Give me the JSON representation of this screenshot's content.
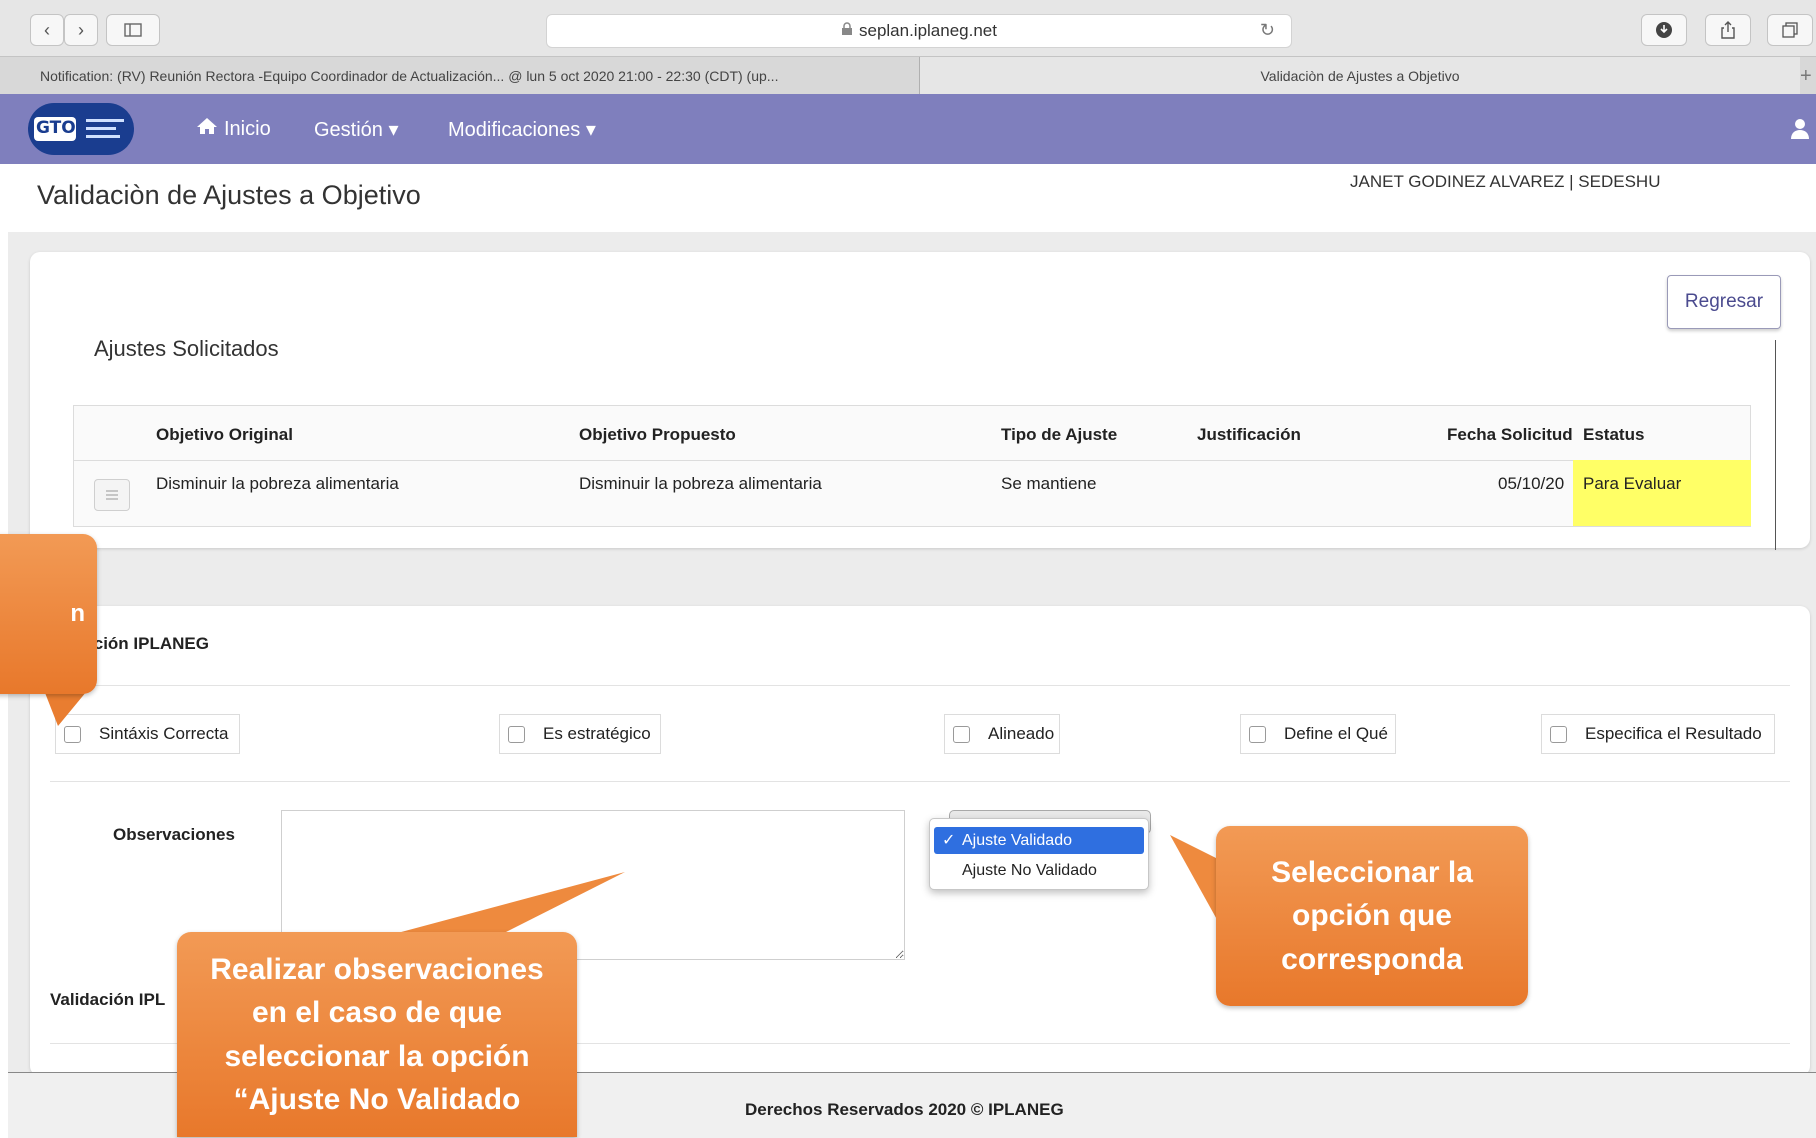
{
  "browser": {
    "url": "seplan.iplaneg.net",
    "lock_icon": "lock-icon",
    "tabs": [
      {
        "label": "Notification: (RV) Reunión Rectora -Equipo Coordinador de Actualización... @ lun 5 oct 2020 21:00 - 22:30 (CDT) (up..."
      },
      {
        "label": "Validaciòn de Ajustes a Objetivo"
      }
    ],
    "new_tab": "+"
  },
  "nav": {
    "logo_text": "GTO",
    "items": [
      {
        "label": "Inicio",
        "icon": "home-icon"
      },
      {
        "label": "Gestión ▾"
      },
      {
        "label": "Modificaciones ▾"
      }
    ]
  },
  "page": {
    "title": "Validaciòn de Ajustes a Objetivo",
    "user": "JANET GODINEZ ALVAREZ | SEDESHU"
  },
  "ajustes": {
    "back_button": "Regresar",
    "section_title": "Ajustes Solicitados",
    "columns": [
      "Objetivo Original",
      "Objetivo Propuesto",
      "Tipo de Ajuste",
      "Justificación",
      "Fecha Solicitud",
      "Estatus"
    ],
    "rows": [
      {
        "objetivo_original": "Disminuir la pobreza alimentaria",
        "objetivo_propuesto": "Disminuir la pobreza alimentaria",
        "tipo": "Se mantiene",
        "justificacion": "",
        "fecha": "05/10/20",
        "estatus": "Para Evaluar"
      }
    ],
    "status_color": "#ffff66"
  },
  "validacion": {
    "section_title": "alidación IPLANEG",
    "checkboxes": [
      {
        "label": "Sintáxis Correcta"
      },
      {
        "label": "Es estratégico"
      },
      {
        "label": "Alineado"
      },
      {
        "label": "Define el Qué"
      },
      {
        "label": "Especifica el Resultado"
      }
    ],
    "observaciones_label": "Observaciones",
    "dropdown_options": [
      {
        "label": "Ajuste Validado",
        "selected": true
      },
      {
        "label": "Ajuste No Validado",
        "selected": false
      }
    ],
    "bottom_label": "Validación IPL"
  },
  "footer": {
    "text": "Derechos Reservados 2020 © IPLANEG"
  },
  "callouts": {
    "left_fragment": "n",
    "observaciones": [
      "Realizar observaciones",
      "en el caso de que",
      "seleccionar la opción",
      "“Ajuste No Validado"
    ],
    "seleccionar": [
      "Seleccionar la",
      "opción que",
      "corresponda"
    ],
    "color": "#ec7d32"
  }
}
